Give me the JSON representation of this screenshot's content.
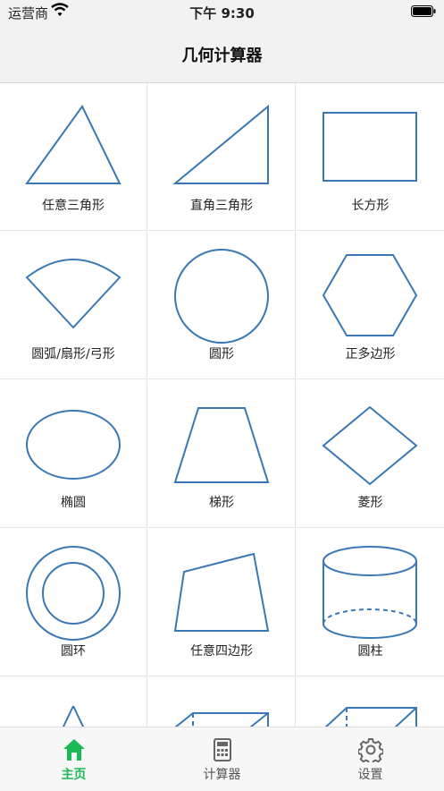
{
  "status_bar": {
    "carrier": "运营商",
    "time": "下午 9:30"
  },
  "header": {
    "title": "几何计算器"
  },
  "shapes": [
    {
      "label": "任意三角形",
      "icon": "triangle-icon"
    },
    {
      "label": "直角三角形",
      "icon": "right-triangle-icon"
    },
    {
      "label": "长方形",
      "icon": "rectangle-icon"
    },
    {
      "label": "圆弧/扇形/弓形",
      "icon": "sector-icon"
    },
    {
      "label": "圆形",
      "icon": "circle-icon"
    },
    {
      "label": "正多边形",
      "icon": "hexagon-icon"
    },
    {
      "label": "椭圆",
      "icon": "ellipse-icon"
    },
    {
      "label": "梯形",
      "icon": "trapezoid-icon"
    },
    {
      "label": "菱形",
      "icon": "rhombus-icon"
    },
    {
      "label": "圆环",
      "icon": "ring-icon"
    },
    {
      "label": "任意四边形",
      "icon": "quadrilateral-icon"
    },
    {
      "label": "圆柱",
      "icon": "cylinder-icon"
    },
    {
      "label": "",
      "icon": "cone-icon"
    },
    {
      "label": "",
      "icon": "cuboid-icon"
    },
    {
      "label": "",
      "icon": "cube-icon"
    }
  ],
  "tabs": [
    {
      "label": "主页",
      "icon": "home-icon",
      "active": true
    },
    {
      "label": "计算器",
      "icon": "calculator-icon",
      "active": false
    },
    {
      "label": "设置",
      "icon": "gear-icon",
      "active": false
    }
  ],
  "colors": {
    "accent": "#1bb955",
    "shape_stroke": "#3a78b5",
    "header_bg": "#f2f2f2"
  }
}
